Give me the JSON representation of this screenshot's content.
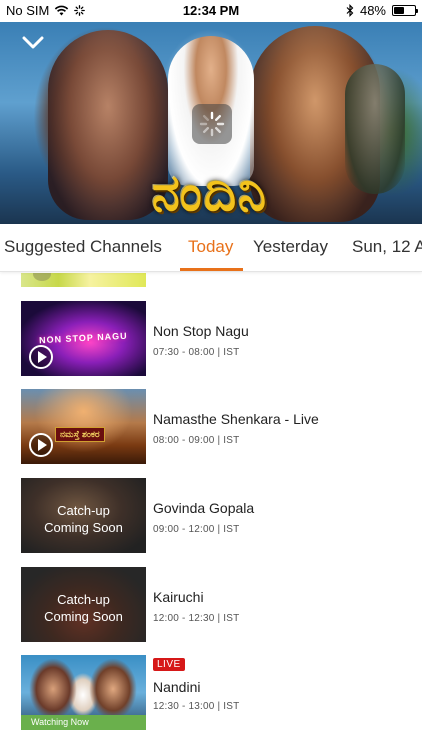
{
  "status_bar": {
    "carrier": "No SIM",
    "time": "12:34 PM",
    "battery_percent": "48%",
    "battery_level": 0.48,
    "icons": [
      "wifi-icon",
      "activity-icon",
      "bluetooth-icon",
      "battery-icon"
    ]
  },
  "hero": {
    "logo_text": "ನಂದಿನಿ",
    "back_icon": "chevron-down-icon",
    "loading_icon": "spinner-icon"
  },
  "tabs": [
    {
      "label": "Suggested Channels",
      "active": false
    },
    {
      "label": "Today",
      "active": true
    },
    {
      "label": "Yesterday",
      "active": false
    },
    {
      "label": "Sun, 12 A",
      "active": false
    }
  ],
  "accent_color": "#e8711a",
  "programs": [
    {
      "title": "Non Stop Nagu",
      "time": "07:30 - 08:00 | IST",
      "thumb_text": "NON STOP NAGU",
      "overlay": "play-icon"
    },
    {
      "title": "Namasthe Shenkara - Live",
      "time": "08:00 - 09:00 | IST",
      "thumb_text": "ನಮಸ್ತೆ ಶಂಕರ",
      "overlay": "play-icon"
    },
    {
      "title": "Govinda Gopala",
      "time": "09:00 - 12:00 | IST",
      "overlay_text_1": "Catch-up",
      "overlay_text_2": "Coming Soon"
    },
    {
      "title": "Kairuchi",
      "time": "12:00 - 12:30 | IST",
      "overlay_text_1": "Catch-up",
      "overlay_text_2": "Coming Soon"
    },
    {
      "title": "Nandini",
      "time": "12:30 - 13:00 | IST",
      "badge": "LIVE",
      "watching_label": "Watching Now"
    }
  ]
}
